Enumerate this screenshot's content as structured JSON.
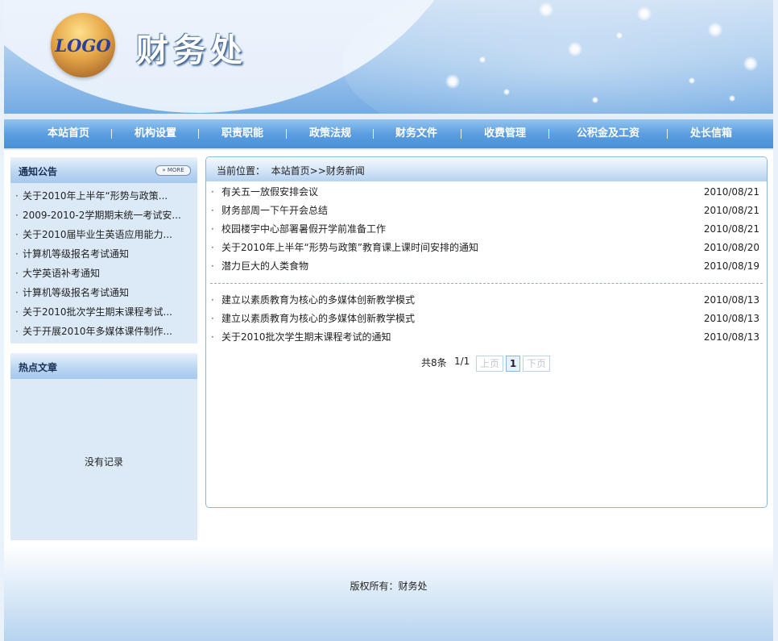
{
  "header": {
    "logo_text": "LOGO",
    "site_title": "财务处"
  },
  "nav": {
    "items": [
      {
        "label": "本站首页"
      },
      {
        "label": "机构设置"
      },
      {
        "label": "职责职能"
      },
      {
        "label": "政策法规"
      },
      {
        "label": "财务文件"
      },
      {
        "label": "收费管理"
      },
      {
        "label": "公积金及工资"
      },
      {
        "label": "处长信箱"
      }
    ]
  },
  "notice": {
    "title": "通知公告",
    "more_label": "» MORE",
    "items": [
      "关于2010年上半年“形势与政策...",
      "2009-2010-2学期期末统一考试安...",
      "关于2010届毕业生英语应用能力...",
      "计算机等级报名考试通知",
      "大学英语补考通知",
      "计算机等级报名考试通知",
      "关于2010批次学生期末课程考试...",
      "关于开展2010年多媒体课件制作..."
    ]
  },
  "hot": {
    "title": "热点文章",
    "empty_text": "没有记录"
  },
  "main": {
    "location_label": "当前位置：",
    "location_path": "本站首页>>财务新闻",
    "news_group_1": [
      {
        "title": "有关五一放假安排会议",
        "date": "2010/08/21"
      },
      {
        "title": "财务部周一下午开会总结",
        "date": "2010/08/21"
      },
      {
        "title": "校园楼宇中心部署暑假开学前准备工作",
        "date": "2010/08/21"
      },
      {
        "title": "关于2010年上半年“形势与政策”教育课上课时间安排的通知",
        "date": "2010/08/20"
      },
      {
        "title": "潜力巨大的人类食物",
        "date": "2010/08/19"
      }
    ],
    "news_group_2": [
      {
        "title": "建立以素质教育为核心的多媒体创新教学模式",
        "date": "2010/08/13"
      },
      {
        "title": "建立以素质教育为核心的多媒体创新教学模式",
        "date": "2010/08/13"
      },
      {
        "title": "关于2010批次学生期末课程考试的通知",
        "date": "2010/08/13"
      }
    ],
    "pager": {
      "total": "共8条",
      "pages": "1/1",
      "prev": "上页",
      "current": "1",
      "next": "下页"
    }
  },
  "footer": {
    "copyright": "版权所有：财务处"
  },
  "colors": {
    "nav_blue": "#5b9ee0",
    "panel_bg": "#dceaf7",
    "border_blue": "#8fb6de"
  }
}
